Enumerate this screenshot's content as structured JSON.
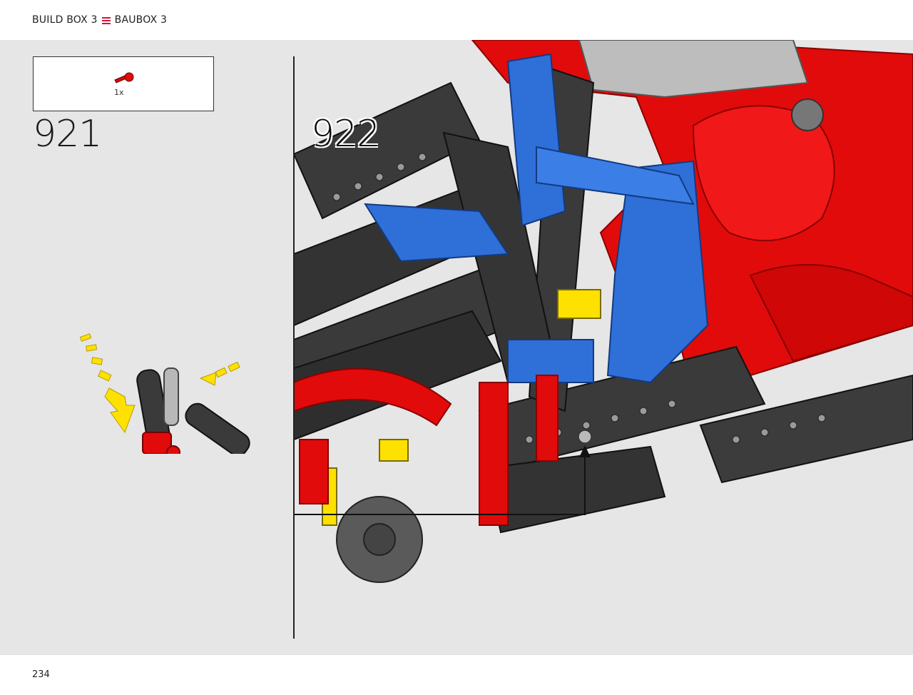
{
  "header": {
    "section_en": "BUILD BOX 3",
    "menu_icon": "hamburger-icon",
    "section_de": "BAUBOX 3"
  },
  "steps": [
    {
      "number": "921",
      "parts": [
        {
          "quantity": "1x",
          "color": "#d10a0a",
          "part": "red-pin-icon"
        }
      ]
    },
    {
      "number": "922"
    }
  ],
  "colors": {
    "accent": "#d6133a",
    "lego_red": "#e10b0b",
    "lego_blue": "#2f6fd8",
    "lego_black": "#3a3a3a",
    "lego_gray": "#a9a9a9",
    "lego_yellow": "#ffe100",
    "background": "#e6e6e6"
  },
  "footer": {
    "page_number": "234"
  }
}
